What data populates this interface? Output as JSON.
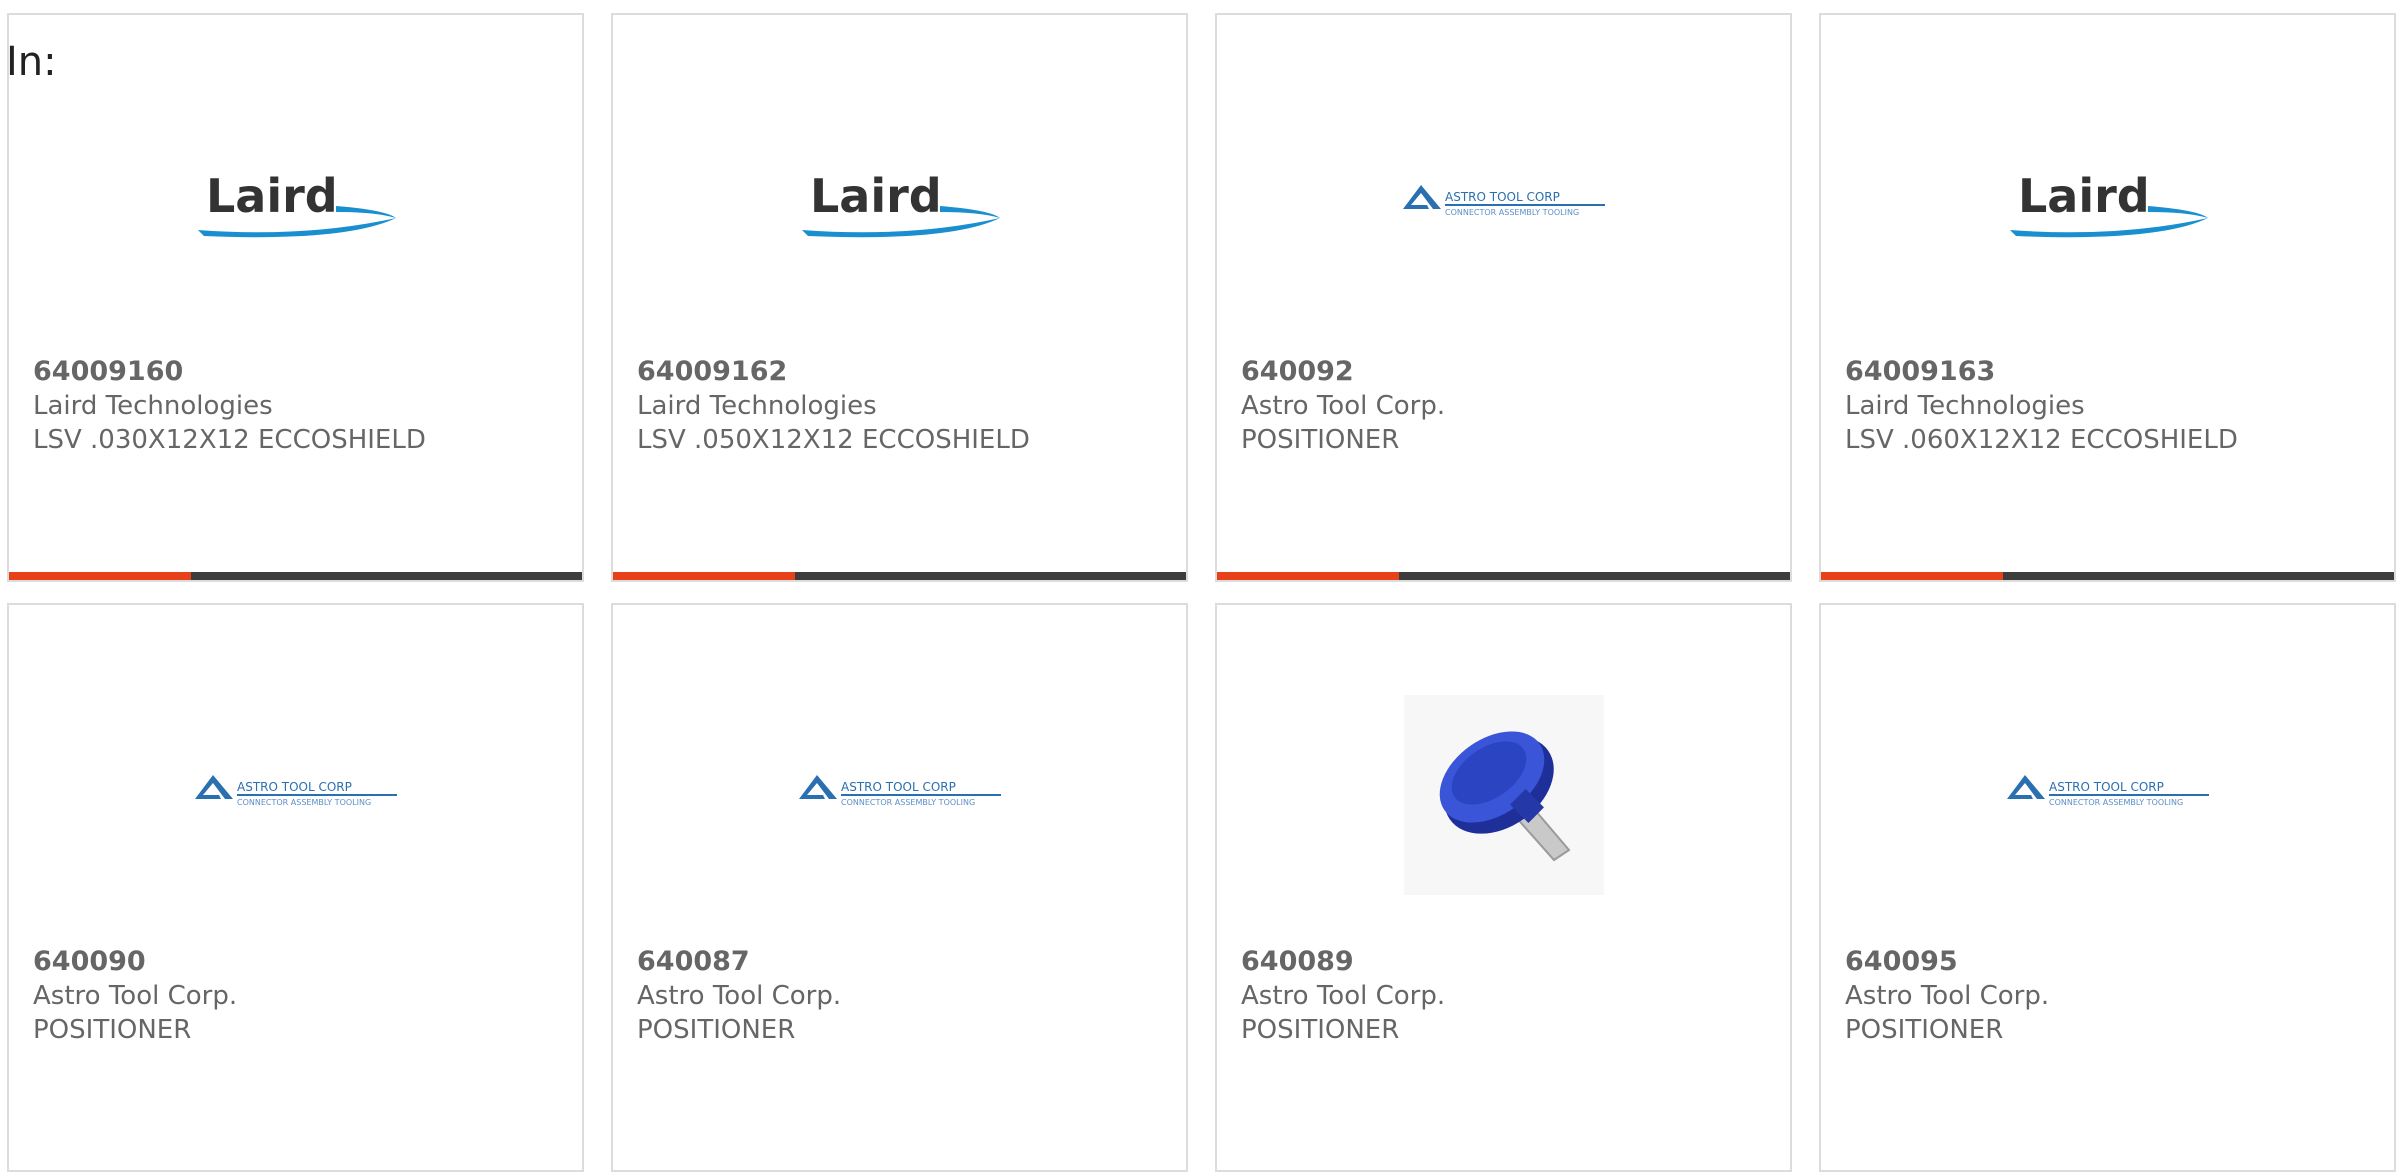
{
  "page": {
    "in_label": "In:"
  },
  "colors": {
    "accent": "#e8411a",
    "bar": "#3c3c3c",
    "laird_blue": "#1a8fd0",
    "astro_blue": "#2a6fb0",
    "knob_blue": "#2a3fb8"
  },
  "products": [
    {
      "part_number": "64009160",
      "manufacturer": "Laird Technologies",
      "description": "LSV .030X12X12 ECCOSHIELD",
      "logo": "laird-logo",
      "logo_text": "Laird"
    },
    {
      "part_number": "64009162",
      "manufacturer": "Laird Technologies",
      "description": "LSV .050X12X12 ECCOSHIELD",
      "logo": "laird-logo",
      "logo_text": "Laird"
    },
    {
      "part_number": "640092",
      "manufacturer": "Astro Tool Corp.",
      "description": "POSITIONER",
      "logo": "astro-tool-logo",
      "logo_text": "ASTRO TOOL CORP",
      "logo_subtext": "CONNECTOR ASSEMBLY TOOLING"
    },
    {
      "part_number": "64009163",
      "manufacturer": "Laird Technologies",
      "description": "LSV .060X12X12 ECCOSHIELD",
      "logo": "laird-logo",
      "logo_text": "Laird"
    },
    {
      "part_number": "640090",
      "manufacturer": "Astro Tool Corp.",
      "description": "POSITIONER",
      "logo": "astro-tool-logo",
      "logo_text": "ASTRO TOOL CORP",
      "logo_subtext": "CONNECTOR ASSEMBLY TOOLING"
    },
    {
      "part_number": "640087",
      "manufacturer": "Astro Tool Corp.",
      "description": "POSITIONER",
      "logo": "astro-tool-logo",
      "logo_text": "ASTRO TOOL CORP",
      "logo_subtext": "CONNECTOR ASSEMBLY TOOLING"
    },
    {
      "part_number": "640089",
      "manufacturer": "Astro Tool Corp.",
      "description": "POSITIONER",
      "logo": "positioner-photo"
    },
    {
      "part_number": "640095",
      "manufacturer": "Astro Tool Corp.",
      "description": "POSITIONER",
      "logo": "astro-tool-logo",
      "logo_text": "ASTRO TOOL CORP",
      "logo_subtext": "CONNECTOR ASSEMBLY TOOLING"
    }
  ]
}
